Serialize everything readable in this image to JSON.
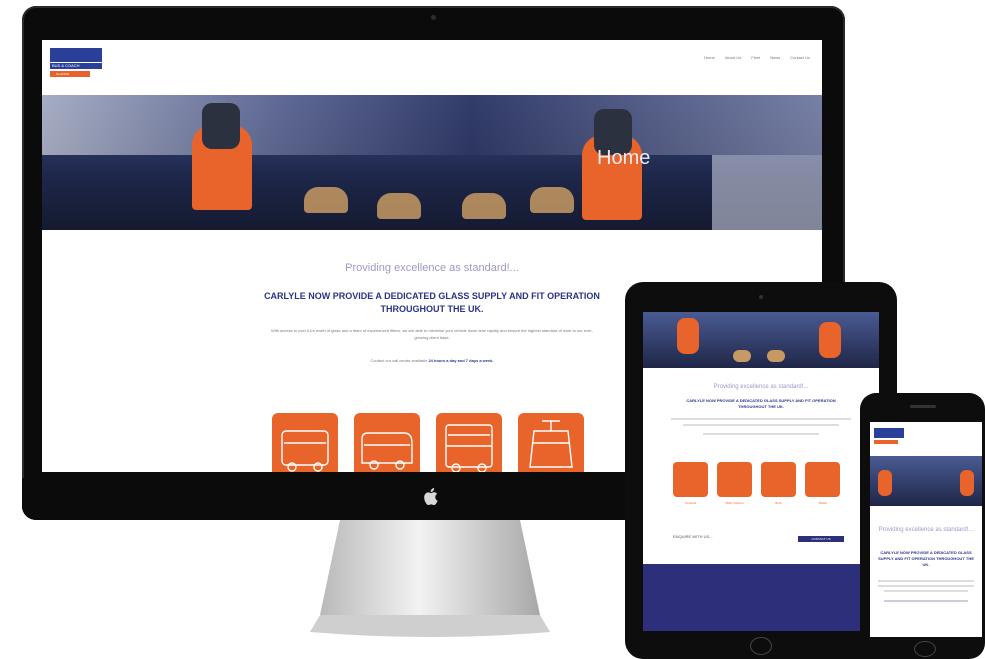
{
  "desktop": {
    "nav": [
      "Home",
      "About Us",
      "Fleet",
      "News",
      "Contact Us"
    ],
    "hero_title": "Home",
    "tagline": "Providing excellence as standard!...",
    "heading": "CARLYLE NOW PROVIDE A DEDICATED GLASS SUPPLY AND FIT OPERATION THROUGHOUT THE UK.",
    "body": "With access to over £1m worth of glass and a team of experienced fitters, we are able to minimise your vehicle down time rapidly and ensure the highest standard of work to our ever-growing client base.",
    "contact_prefix": "Contact our call centre available ",
    "contact_highlight": "24 hours a day and 7 days a week."
  },
  "logo": {
    "line2": "BUS & COACH",
    "line3": "GLAZING"
  },
  "tablet": {
    "tagline": "Providing excellence as standard!...",
    "heading": "CARLYLE NOW PROVIDE A DEDICATED GLASS SUPPLY AND FIT OPERATION THROUGHOUT THE UK.",
    "tile_labels": [
      "COACH",
      "MINI COACH",
      "BUS",
      "TRAM"
    ],
    "enquiry_label": "ENQUIRE WITH US...",
    "enquiry_button": "CONTACT US"
  },
  "phone": {
    "tagline": "Providing excellence as standard!...",
    "heading": "CARLYLE NOW PROVIDE A DEDICATED GLASS SUPPLY AND FIT OPERATION THROUGHOUT THE UK."
  },
  "colors": {
    "brand_blue": "#2a3489",
    "brand_orange": "#e8642a",
    "footer_purple": "#2d2f7a"
  },
  "icons": [
    "apple-logo-icon",
    "coach-icon",
    "mini-coach-icon",
    "double-decker-bus-icon",
    "tram-icon"
  ]
}
